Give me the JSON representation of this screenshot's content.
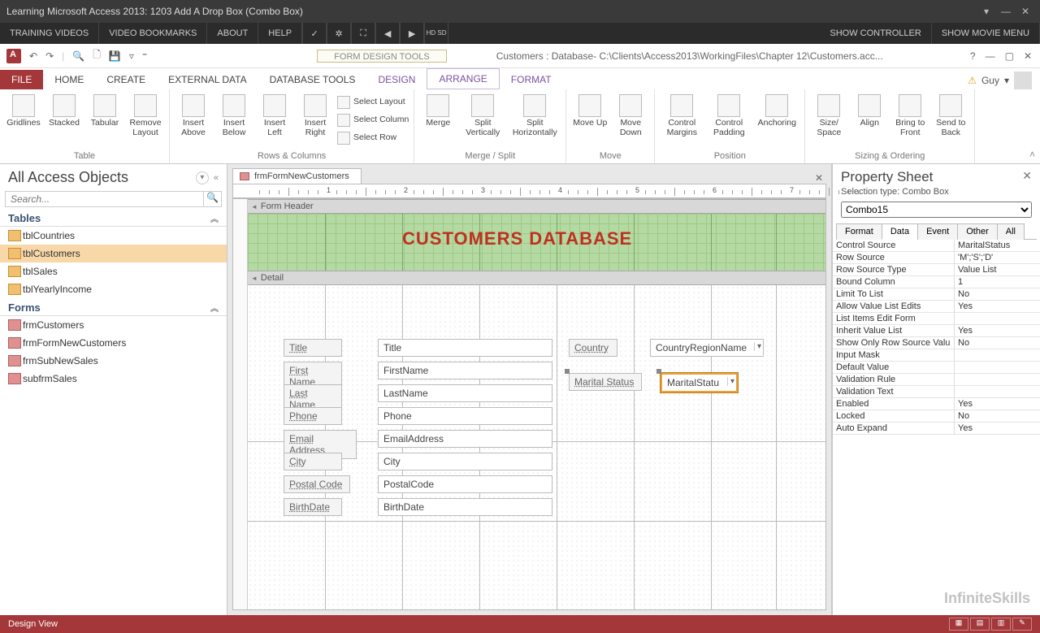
{
  "window": {
    "title": "Learning Microsoft Access 2013: 1203 Add A Drop Box (Combo Box)"
  },
  "player": {
    "training_videos": "TRAINING VIDEOS",
    "video_bookmarks": "VIDEO BOOKMARKS",
    "about": "ABOUT",
    "help": "HELP",
    "show_controller": "SHOW CONTROLLER",
    "show_movie_menu": "SHOW MOVIE MENU",
    "hd_sd": "HD SD"
  },
  "access": {
    "context_title": "FORM DESIGN TOOLS",
    "doc_title": "Customers : Database- C:\\Clients\\Access2013\\WorkingFiles\\Chapter 12\\Customers.acc...",
    "user": "Guy"
  },
  "tabs": {
    "file": "FILE",
    "home": "HOME",
    "create": "CREATE",
    "external": "EXTERNAL DATA",
    "dbtools": "DATABASE TOOLS",
    "design": "DESIGN",
    "arrange": "ARRANGE",
    "format": "FORMAT"
  },
  "ribbon": {
    "groups": {
      "table": "Table",
      "rows_cols": "Rows & Columns",
      "merge_split": "Merge / Split",
      "move": "Move",
      "position": "Position",
      "sizing": "Sizing & Ordering"
    },
    "gridlines": "Gridlines",
    "stacked": "Stacked",
    "tabular": "Tabular",
    "remove_layout": "Remove Layout",
    "insert_above": "Insert Above",
    "insert_below": "Insert Below",
    "insert_left": "Insert Left",
    "insert_right": "Insert Right",
    "select_layout": "Select Layout",
    "select_column": "Select Column",
    "select_row": "Select Row",
    "merge": "Merge",
    "split_v": "Split Vertically",
    "split_h": "Split Horizontally",
    "move_up": "Move Up",
    "move_down": "Move Down",
    "control_margins": "Control Margins",
    "control_padding": "Control Padding",
    "anchoring": "Anchoring",
    "size_space": "Size/ Space",
    "align": "Align",
    "bring_front": "Bring to Front",
    "send_back": "Send to Back"
  },
  "nav": {
    "title": "All Access Objects",
    "search_placeholder": "Search...",
    "cat_tables": "Tables",
    "cat_forms": "Forms",
    "tables": [
      "tblCountries",
      "tblCustomers",
      "tblSales",
      "tblYearlyIncome"
    ],
    "forms": [
      "frmCustomers",
      "frmFormNewCustomers",
      "frmSubNewSales",
      "subfrmSales"
    ],
    "selected": "tblCustomers"
  },
  "doc": {
    "tab": "frmFormNewCustomers"
  },
  "form": {
    "header_section": "Form Header",
    "detail_section": "Detail",
    "title_text": "CUSTOMERS DATABASE",
    "labels": {
      "title": "Title",
      "first": "First Name",
      "last": "Last Name",
      "phone": "Phone",
      "email": "Email Address",
      "city": "City",
      "postal": "Postal Code",
      "birth": "BirthDate",
      "country": "Country",
      "marital": "Marital Status"
    },
    "bound": {
      "title": "Title",
      "first": "FirstName",
      "last": "LastName",
      "phone": "Phone",
      "email": "EmailAddress",
      "city": "City",
      "postal": "PostalCode",
      "birth": "BirthDate",
      "country": "CountryRegionName",
      "marital": "MaritalStatu"
    }
  },
  "props": {
    "title": "Property Sheet",
    "sel_type_label": "Selection type:",
    "sel_type": "Combo Box",
    "control_name": "Combo15",
    "tabs": [
      "Format",
      "Data",
      "Event",
      "Other",
      "All"
    ],
    "active_tab": "Data",
    "rows": [
      {
        "k": "Control Source",
        "v": "MaritalStatus"
      },
      {
        "k": "Row Source",
        "v": "'M';'S';'D'"
      },
      {
        "k": "Row Source Type",
        "v": "Value List"
      },
      {
        "k": "Bound Column",
        "v": "1"
      },
      {
        "k": "Limit To List",
        "v": "No"
      },
      {
        "k": "Allow Value List Edits",
        "v": "Yes"
      },
      {
        "k": "List Items Edit Form",
        "v": ""
      },
      {
        "k": "Inherit Value List",
        "v": "Yes"
      },
      {
        "k": "Show Only Row Source Valu",
        "v": "No"
      },
      {
        "k": "Input Mask",
        "v": ""
      },
      {
        "k": "Default Value",
        "v": ""
      },
      {
        "k": "Validation Rule",
        "v": ""
      },
      {
        "k": "Validation Text",
        "v": ""
      },
      {
        "k": "Enabled",
        "v": "Yes"
      },
      {
        "k": "Locked",
        "v": "No"
      },
      {
        "k": "Auto Expand",
        "v": "Yes"
      }
    ]
  },
  "status": {
    "mode": "Design View"
  },
  "watermark": "InfiniteSkills"
}
